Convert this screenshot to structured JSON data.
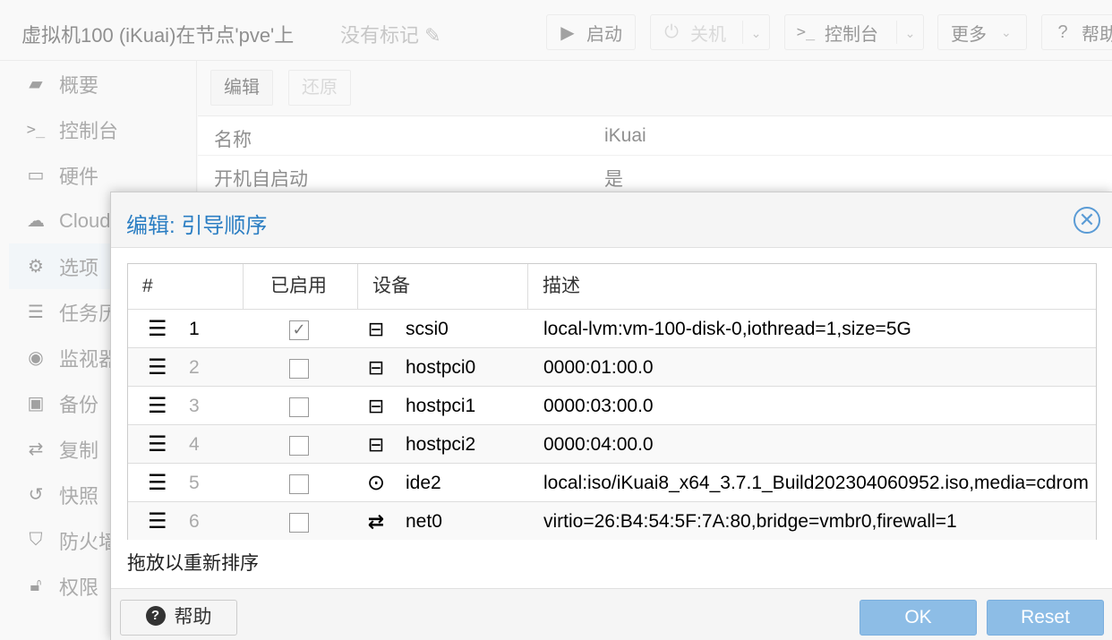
{
  "header": {
    "title": "虚拟机100 (iKuai)在节点'pve'上",
    "tags": "没有标记",
    "buttons": {
      "start": "启动",
      "shutdown": "关机",
      "console": "控制台",
      "more": "更多",
      "help": "帮助"
    }
  },
  "sidebar": {
    "items": [
      {
        "label": "概要",
        "icon": "book-icon"
      },
      {
        "label": "控制台",
        "icon": "terminal-icon"
      },
      {
        "label": "硬件",
        "icon": "monitor-icon"
      },
      {
        "label": "Cloud",
        "icon": "cloud-icon"
      },
      {
        "label": "选项",
        "icon": "gear-icon"
      },
      {
        "label": "任务历",
        "icon": "list-icon"
      },
      {
        "label": "监视器",
        "icon": "eye-icon"
      },
      {
        "label": "备份",
        "icon": "floppy-icon"
      },
      {
        "label": "复制",
        "icon": "retweet-icon"
      },
      {
        "label": "快照",
        "icon": "history-icon"
      },
      {
        "label": "防火墙",
        "icon": "shield-icon"
      },
      {
        "label": "权限",
        "icon": "unlock-icon"
      }
    ]
  },
  "content": {
    "edit_label": "编辑",
    "revert_label": "还原",
    "rows": [
      {
        "key": "名称",
        "value": "iKuai"
      },
      {
        "key": "开机自启动",
        "value": "是"
      }
    ]
  },
  "dialog": {
    "title": "编辑: 引导顺序",
    "columns": {
      "num": "#",
      "enabled": "已启用",
      "device": "设备",
      "description": "描述"
    },
    "rows": [
      {
        "num": "1",
        "enabled": true,
        "icon": "hdd-icon",
        "device": "scsi0",
        "description": "local-lvm:vm-100-disk-0,iothread=1,size=5G"
      },
      {
        "num": "2",
        "enabled": false,
        "icon": "hdd-icon",
        "device": "hostpci0",
        "description": "0000:01:00.0"
      },
      {
        "num": "3",
        "enabled": false,
        "icon": "hdd-icon",
        "device": "hostpci1",
        "description": "0000:03:00.0"
      },
      {
        "num": "4",
        "enabled": false,
        "icon": "hdd-icon",
        "device": "hostpci2",
        "description": "0000:04:00.0"
      },
      {
        "num": "5",
        "enabled": false,
        "icon": "disc-icon",
        "device": "ide2",
        "description": "local:iso/iKuai8_x64_3.7.1_Build202304060952.iso,media=cdrom"
      },
      {
        "num": "6",
        "enabled": false,
        "icon": "exchange-icon",
        "device": "net0",
        "description": "virtio=26:B4:54:5F:7A:80,bridge=vmbr0,firewall=1"
      }
    ],
    "hint": "拖放以重新排序",
    "help_label": "帮助",
    "ok_label": "OK",
    "reset_label": "Reset"
  }
}
